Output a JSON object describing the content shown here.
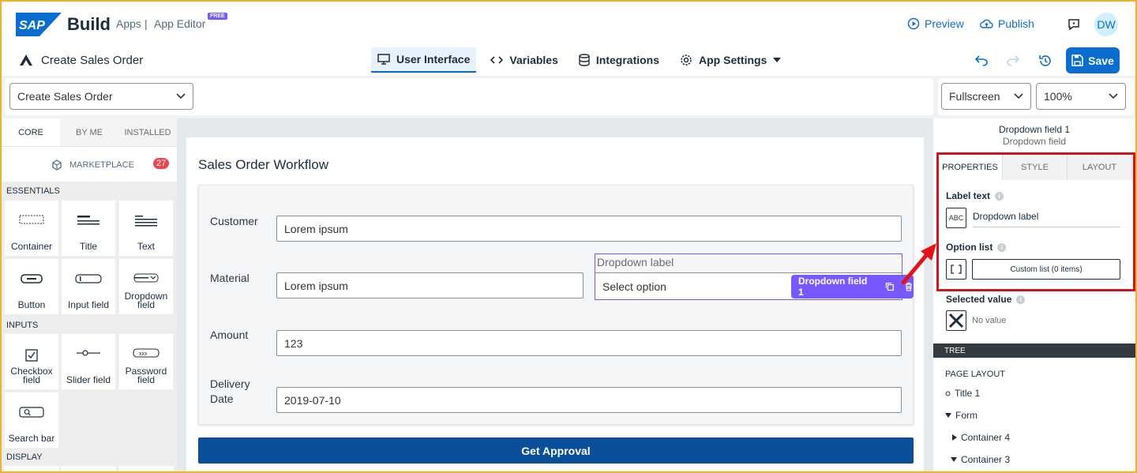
{
  "header": {
    "logo": "SAP",
    "brand": "Build",
    "apps": "Apps",
    "separator": "|",
    "editor": "App Editor",
    "free_badge": "FREE",
    "preview": "Preview",
    "publish": "Publish",
    "avatar": "DW"
  },
  "page_title": "Create Sales Order",
  "tabs": [
    {
      "label": "User Interface",
      "icon": "monitor-icon",
      "active": true
    },
    {
      "label": "Variables",
      "icon": "code-icon"
    },
    {
      "label": "Integrations",
      "icon": "database-icon"
    },
    {
      "label": "App Settings",
      "icon": "gear-icon"
    }
  ],
  "toolbar": {
    "save_label": "Save"
  },
  "page_select": {
    "value": "Create Sales Order"
  },
  "view_select": {
    "value": "Fullscreen"
  },
  "zoom_select": {
    "value": "100%"
  },
  "left_panel": {
    "tabs": [
      "CORE",
      "BY ME",
      "INSTALLED"
    ],
    "marketplace": "MARKETPLACE",
    "marketplace_count": "27",
    "sections": {
      "essentials": "ESSENTIALS",
      "inputs": "INPUTS",
      "display": "DISPLAY"
    },
    "components": {
      "container": "Container",
      "title": "Title",
      "text": "Text",
      "button": "Button",
      "input_field": "Input field",
      "dropdown_field": "Dropdown field",
      "checkbox_field": "Checkbox field",
      "slider_field": "Slider field",
      "password_field": "Password field",
      "search_bar": "Search bar"
    }
  },
  "canvas": {
    "title": "Sales Order Workflow",
    "fields": {
      "customer_label": "Customer",
      "customer_value": "Lorem ipsum",
      "material_label": "Material",
      "material_value": "Lorem ipsum",
      "dropdown_label": "Dropdown label",
      "dropdown_placeholder": "Select option",
      "amount_label": "Amount",
      "amount_value": "123",
      "delivery_label_1": "Delivery",
      "delivery_label_2": "Date",
      "delivery_value": "2019-07-10"
    },
    "selected_chip": "Dropdown field 1",
    "button": "Get Approval"
  },
  "right_panel": {
    "component_name": "Dropdown field 1",
    "component_type": "Dropdown field",
    "tabs": [
      "PROPERTIES",
      "STYLE",
      "LAYOUT"
    ],
    "label_text_title": "Label text",
    "label_text_value": "Dropdown label",
    "label_text_icon": "ABC",
    "option_list_title": "Option list",
    "option_list_button": "Custom list (0 items)",
    "selected_value_title": "Selected value",
    "selected_value_text": "No value",
    "tree_header": "TREE",
    "tree": {
      "page_layout": "PAGE LAYOUT",
      "title1": "Title 1",
      "form": "Form",
      "container4": "Container 4",
      "container3": "Container 3"
    }
  },
  "colors": {
    "accent": "#0a6ed1",
    "selection": "#7858ff",
    "highlight": "#d1141b",
    "button": "#0b4f9a"
  }
}
